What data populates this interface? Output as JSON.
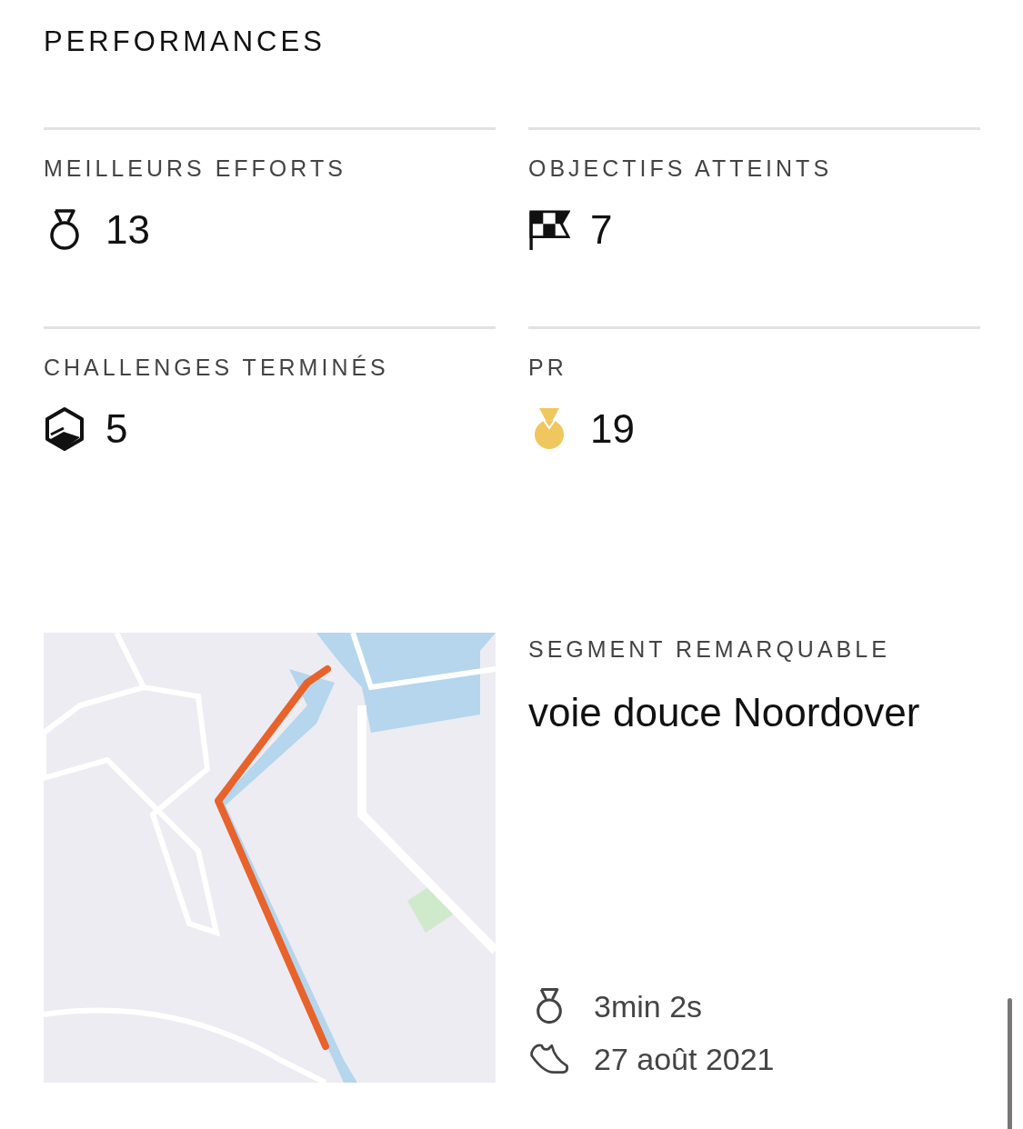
{
  "section_title": "PERFORMANCES",
  "stats": [
    {
      "label": "MEILLEURS EFFORTS",
      "kind": "medal",
      "value": "13"
    },
    {
      "label": "OBJECTIFS ATTEINTS",
      "kind": "flag",
      "value": "7"
    },
    {
      "label": "CHALLENGES TERMINÉS",
      "kind": "challenge",
      "value": "5"
    },
    {
      "label": "PR",
      "kind": "pr",
      "value": "19"
    }
  ],
  "segment": {
    "label": "SEGMENT REMARQUABLE",
    "name": "voie douce Noordover",
    "details": [
      {
        "kind": "medal",
        "text": "3min 2s"
      },
      {
        "kind": "shoe",
        "text": "27 août 2021"
      }
    ]
  }
}
